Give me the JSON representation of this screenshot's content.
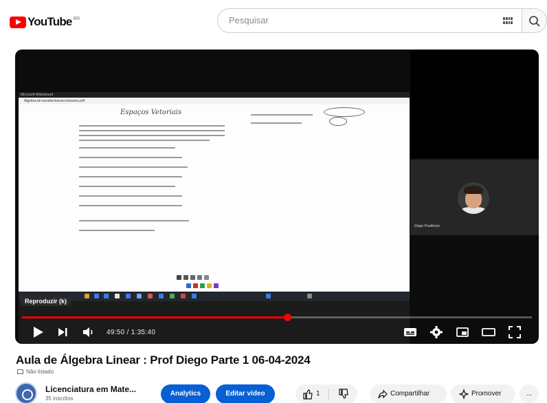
{
  "header": {
    "logo_text": "YouTube",
    "logo_region": "BR",
    "search_placeholder": "Pesquisar"
  },
  "player": {
    "badge": "Reproduzir (k)",
    "time": "49:50 / 1:35:40",
    "progress": 0.52,
    "colors": {
      "progress": "#ff0000"
    },
    "shared_screen": {
      "window_title": "Microsoft Whiteboard",
      "browser_tab": "Algebra-de-transformacoes-lineares.pdf",
      "doc_heading": "Espaços Vetoriais"
    },
    "participant_name": "Diego Prudêncio"
  },
  "video": {
    "title": "Aula de Álgebra Linear : Prof Diego Parte 1 06-04-2024",
    "visibility": "Não listado"
  },
  "channel": {
    "name": "Licenciatura em Mate...",
    "subscribers": "35 inscritos"
  },
  "actions": {
    "analytics": "Analytics",
    "edit": "Editar vídeo",
    "likes": "1",
    "share": "Compartilhar",
    "promote": "Promover",
    "more": "..."
  }
}
